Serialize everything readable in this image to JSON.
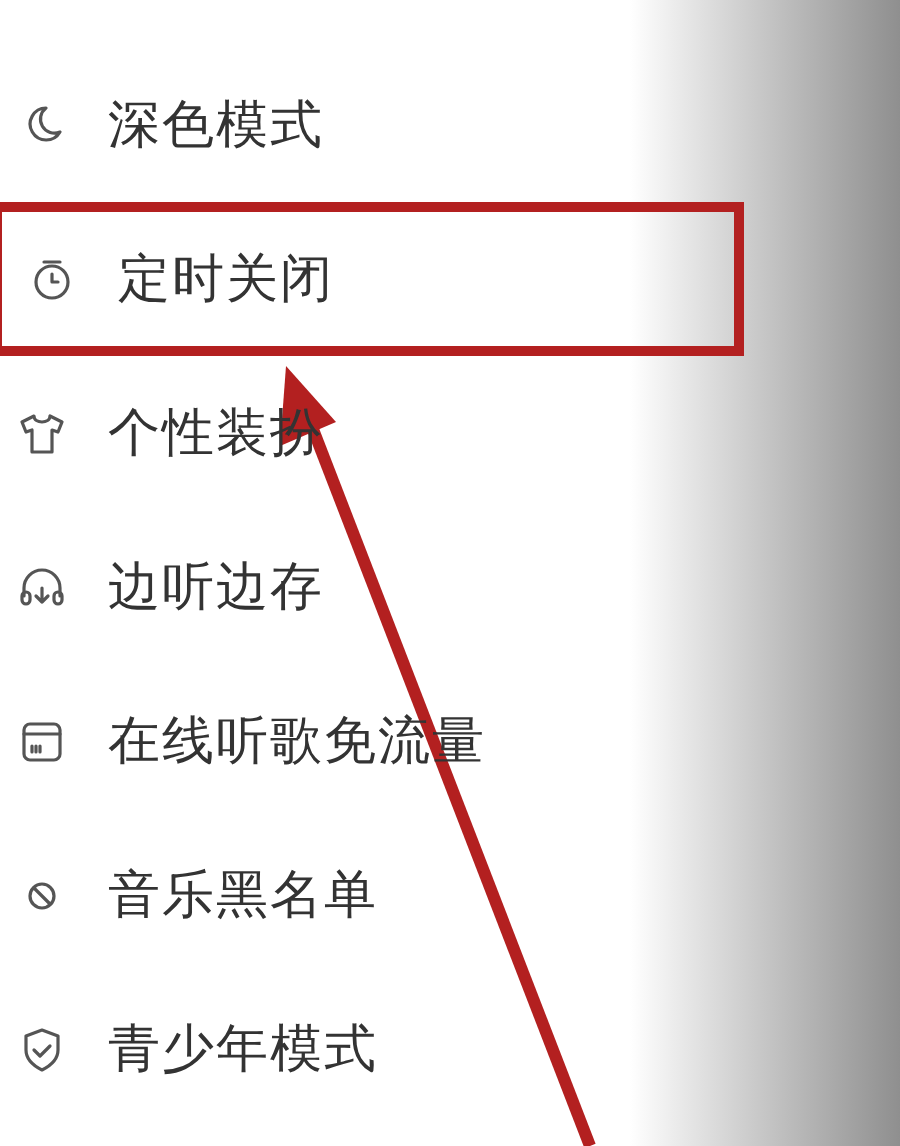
{
  "menu": {
    "items": [
      {
        "kind": "moon",
        "label": "深色模式",
        "highlighted": false
      },
      {
        "kind": "timer",
        "label": "定时关闭",
        "highlighted": true
      },
      {
        "kind": "shirt",
        "label": "个性装扮",
        "highlighted": false
      },
      {
        "kind": "headphones",
        "label": "边听边存",
        "highlighted": false
      },
      {
        "kind": "card",
        "label": "在线听歌免流量",
        "highlighted": false
      },
      {
        "kind": "block",
        "label": "音乐黑名单",
        "highlighted": false
      },
      {
        "kind": "shield",
        "label": "青少年模式",
        "highlighted": false
      }
    ]
  }
}
